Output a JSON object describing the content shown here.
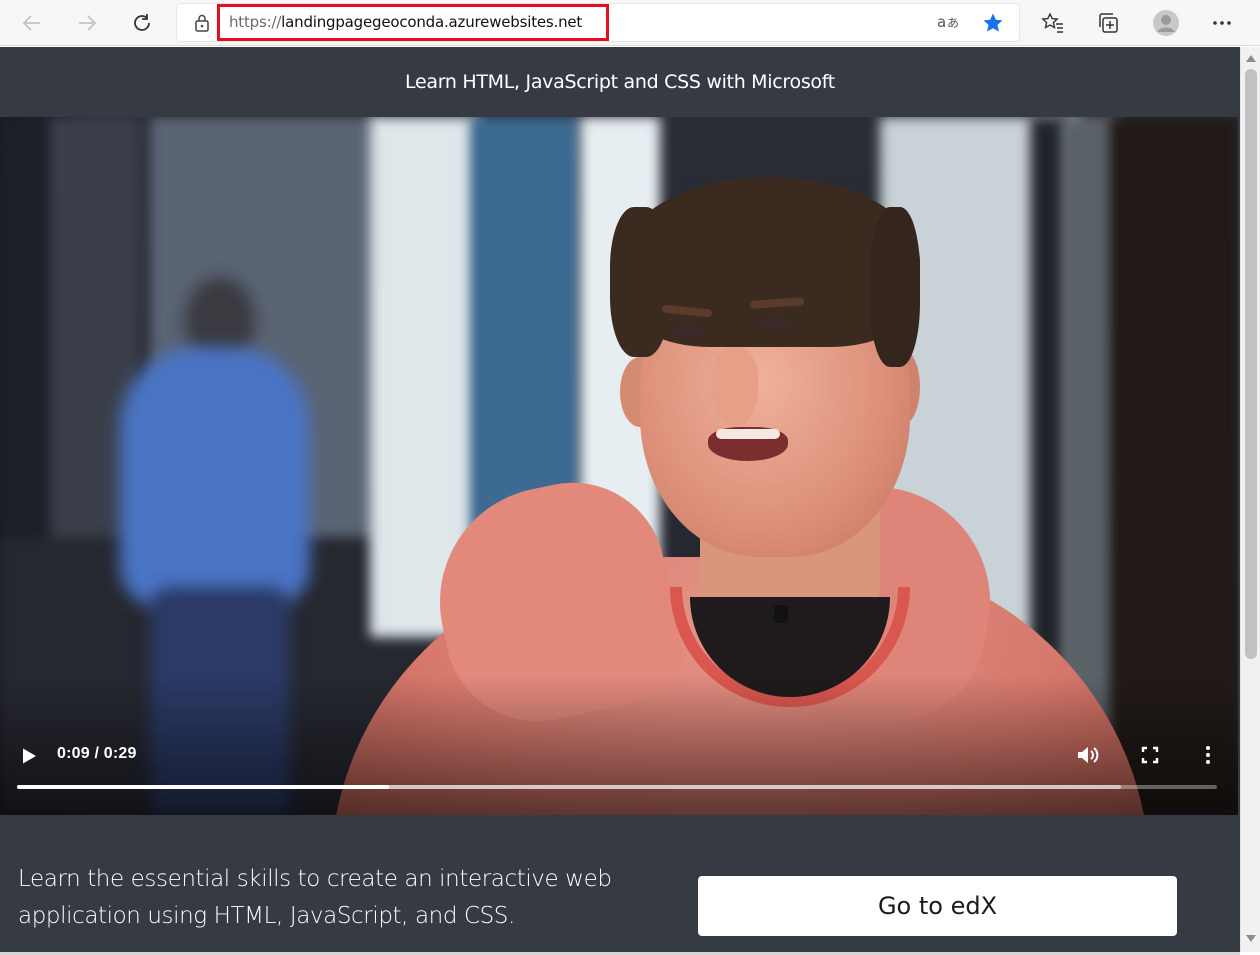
{
  "browser": {
    "url_scheme": "https://",
    "url_host": "landingpagegeoconda.azurewebsites.net",
    "icons": [
      "back-arrow-icon",
      "forward-arrow-icon",
      "refresh-icon",
      "lock-icon",
      "read-aloud-icon",
      "favorite-star-icon",
      "favorites-list-icon",
      "collections-icon",
      "profile-avatar-icon",
      "more-menu-icon"
    ],
    "accent_color": "#1a73e8",
    "highlight_color": "#e0101e"
  },
  "page": {
    "header_title": "Learn HTML, JavaScript and CSS with Microsoft",
    "background_color": "#363a42"
  },
  "video": {
    "time_display": "0:09 / 0:29",
    "current_seconds": 9,
    "duration_seconds": 29,
    "buffered_fraction": 0.92,
    "state": "paused"
  },
  "description": {
    "line1": "Learn the essential skills to create an interactive web",
    "line2": "application using HTML, JavaScript, and CSS."
  },
  "cta": {
    "label": "Go to edX"
  }
}
